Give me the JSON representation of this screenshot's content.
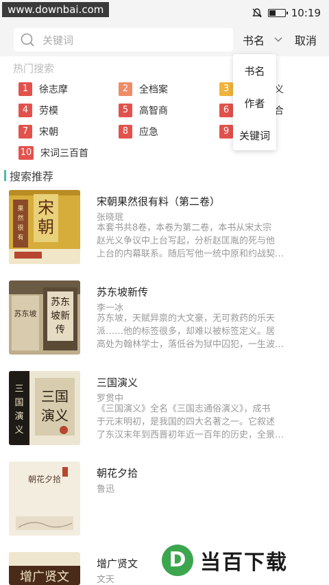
{
  "status": {
    "watermark": "www.downbai.com",
    "time": "10:19"
  },
  "search": {
    "placeholder": "关键词",
    "scope_selected": "书名",
    "cancel": "取消"
  },
  "hot": {
    "title": "热门搜索",
    "items": [
      {
        "rank": "1",
        "label": "徐志摩",
        "color": "#e2524c"
      },
      {
        "rank": "2",
        "label": "全档案",
        "color": "#ee8c67"
      },
      {
        "rank": "3",
        "label": "义",
        "color": "#f0b43c"
      },
      {
        "rank": "4",
        "label": "劳模",
        "color": "#e2524c"
      },
      {
        "rank": "5",
        "label": "高智商",
        "color": "#e2524c"
      },
      {
        "rank": "6",
        "label": "合",
        "color": "#e2524c"
      },
      {
        "rank": "7",
        "label": "宋朝",
        "color": "#e2524c"
      },
      {
        "rank": "8",
        "label": "应急",
        "color": "#e2524c"
      },
      {
        "rank": "9",
        "label": "",
        "color": "#e2524c"
      },
      {
        "rank": "10",
        "label": "宋词三百首",
        "color": "#e2524c"
      }
    ]
  },
  "dropdown": {
    "items": [
      "书名",
      "作者",
      "关键词"
    ]
  },
  "recommend": {
    "title": "搜索推荐",
    "books": [
      {
        "title": "宋朝果然很有料（第二卷）",
        "author": "张晓珉",
        "desc": [
          "本套书共8卷，本卷为第二卷，本书从宋太宗",
          "赵光义争议中上台写起，分析赵匡胤的死与他",
          "上台的内幕联系。随后写他一统中原和约战契…"
        ]
      },
      {
        "title": "苏东坡新传",
        "author": "李一冰",
        "desc": [
          "苏东坡，天赋异禀的大文豪，无可救药的乐天",
          "派……他的标签很多，却难以被标签定义。居",
          "高处为翰林学士，落低谷为狱中囚犯，一生波…"
        ]
      },
      {
        "title": "三国演义",
        "author": "罗贯中",
        "desc": [
          "《三国演义》全名《三国志通俗演义》，成书",
          "于元末明初，是我国的四大名著之一。它叙述",
          "了东汉末年到西晋初年近一百年的历史，全景…"
        ]
      },
      {
        "title": "朝花夕拾",
        "author": "鲁迅",
        "desc": []
      },
      {
        "title": "增广贤文",
        "author": "文天",
        "desc": []
      }
    ],
    "covers": [
      {
        "text": "宋朝",
        "sub": "果然很有料",
        "bg": "#d9b23d",
        "fg": "#5a3a1a"
      },
      {
        "text": "苏东坡新传",
        "sub": "",
        "bg": "#c9b99a",
        "fg": "#3a2a1a"
      },
      {
        "text": "三国演义",
        "sub": "",
        "bg": "#e9e1cc",
        "fg": "#2a1a10"
      },
      {
        "text": "朝花夕拾",
        "sub": "",
        "bg": "#f3ede0",
        "fg": "#5a4030"
      },
      {
        "text": "增广贤文",
        "sub": "",
        "bg": "#efe6cf",
        "fg": "#3a2a1a"
      }
    ]
  },
  "logo": {
    "letter": "D",
    "text": "当百下载"
  }
}
